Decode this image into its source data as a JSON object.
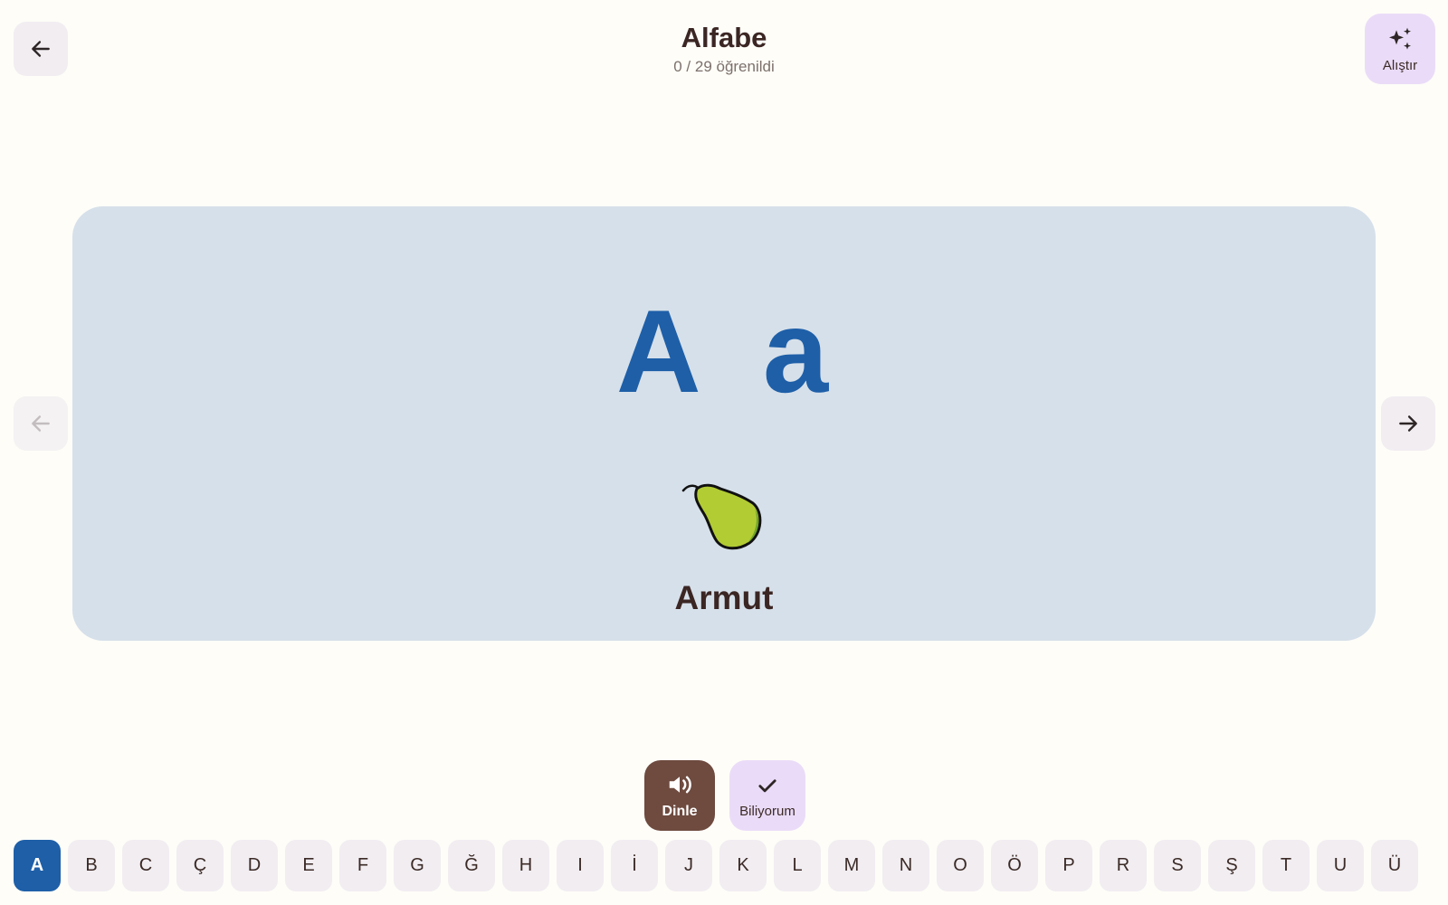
{
  "header": {
    "title": "Alfabe",
    "progress": "0 / 29 öğrenildi",
    "back_icon": "arrow-left-icon"
  },
  "practice": {
    "label": "Alıştır",
    "icon": "sparkles-icon",
    "color": "#eadcf8"
  },
  "card": {
    "upper": "A",
    "lower": "a",
    "image_icon": "pear-icon",
    "word": "Armut",
    "background": "#d6e0ea",
    "letter_color": "#1e5fa8"
  },
  "nav": {
    "prev_icon": "arrow-left-icon",
    "next_icon": "arrow-right-icon"
  },
  "actions": {
    "listen_label": "Dinle",
    "listen_icon": "speaker-icon",
    "listen_color": "#6e4a3f",
    "know_label": "Biliyorum",
    "know_icon": "check-icon"
  },
  "alphabet": {
    "selected": "A",
    "letters": [
      "A",
      "B",
      "C",
      "Ç",
      "D",
      "E",
      "F",
      "G",
      "Ğ",
      "H",
      "I",
      "İ",
      "J",
      "K",
      "L",
      "M",
      "N",
      "O",
      "Ö",
      "P",
      "R",
      "S",
      "Ş",
      "T",
      "U",
      "Ü"
    ]
  }
}
